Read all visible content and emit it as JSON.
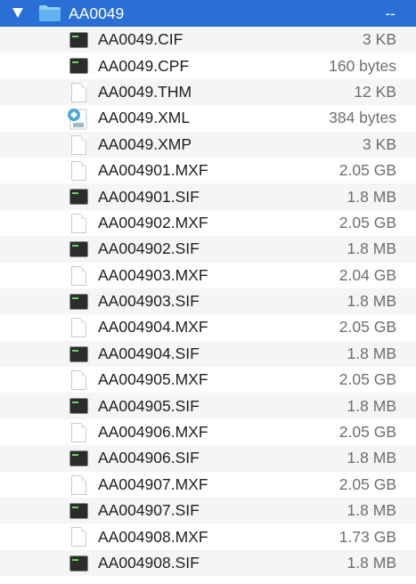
{
  "folder": {
    "name": "AA0049",
    "size": "--"
  },
  "files": [
    {
      "name": "AA0049.CIF",
      "size": "3 KB",
      "icon": "terminal-exec"
    },
    {
      "name": "AA0049.CPF",
      "size": "160 bytes",
      "icon": "terminal-exec"
    },
    {
      "name": "AA0049.THM",
      "size": "12 KB",
      "icon": "blank-document"
    },
    {
      "name": "AA0049.XML",
      "size": "384 bytes",
      "icon": "xml-document"
    },
    {
      "name": "AA0049.XMP",
      "size": "3 KB",
      "icon": "blank-document"
    },
    {
      "name": "AA004901.MXF",
      "size": "2.05 GB",
      "icon": "blank-document"
    },
    {
      "name": "AA004901.SIF",
      "size": "1.8 MB",
      "icon": "terminal-exec"
    },
    {
      "name": "AA004902.MXF",
      "size": "2.05 GB",
      "icon": "blank-document"
    },
    {
      "name": "AA004902.SIF",
      "size": "1.8 MB",
      "icon": "terminal-exec"
    },
    {
      "name": "AA004903.MXF",
      "size": "2.04 GB",
      "icon": "blank-document"
    },
    {
      "name": "AA004903.SIF",
      "size": "1.8 MB",
      "icon": "terminal-exec"
    },
    {
      "name": "AA004904.MXF",
      "size": "2.05 GB",
      "icon": "blank-document"
    },
    {
      "name": "AA004904.SIF",
      "size": "1.8 MB",
      "icon": "terminal-exec"
    },
    {
      "name": "AA004905.MXF",
      "size": "2.05 GB",
      "icon": "blank-document"
    },
    {
      "name": "AA004905.SIF",
      "size": "1.8 MB",
      "icon": "terminal-exec"
    },
    {
      "name": "AA004906.MXF",
      "size": "2.05 GB",
      "icon": "blank-document"
    },
    {
      "name": "AA004906.SIF",
      "size": "1.8 MB",
      "icon": "terminal-exec"
    },
    {
      "name": "AA004907.MXF",
      "size": "2.05 GB",
      "icon": "blank-document"
    },
    {
      "name": "AA004907.SIF",
      "size": "1.8 MB",
      "icon": "terminal-exec"
    },
    {
      "name": "AA004908.MXF",
      "size": "1.73 GB",
      "icon": "blank-document"
    },
    {
      "name": "AA004908.SIF",
      "size": "1.8 MB",
      "icon": "terminal-exec"
    }
  ],
  "colors": {
    "selection": "#2a6fd6",
    "folder": "#5fb4ee",
    "alt_row": "#f4f5f5"
  }
}
